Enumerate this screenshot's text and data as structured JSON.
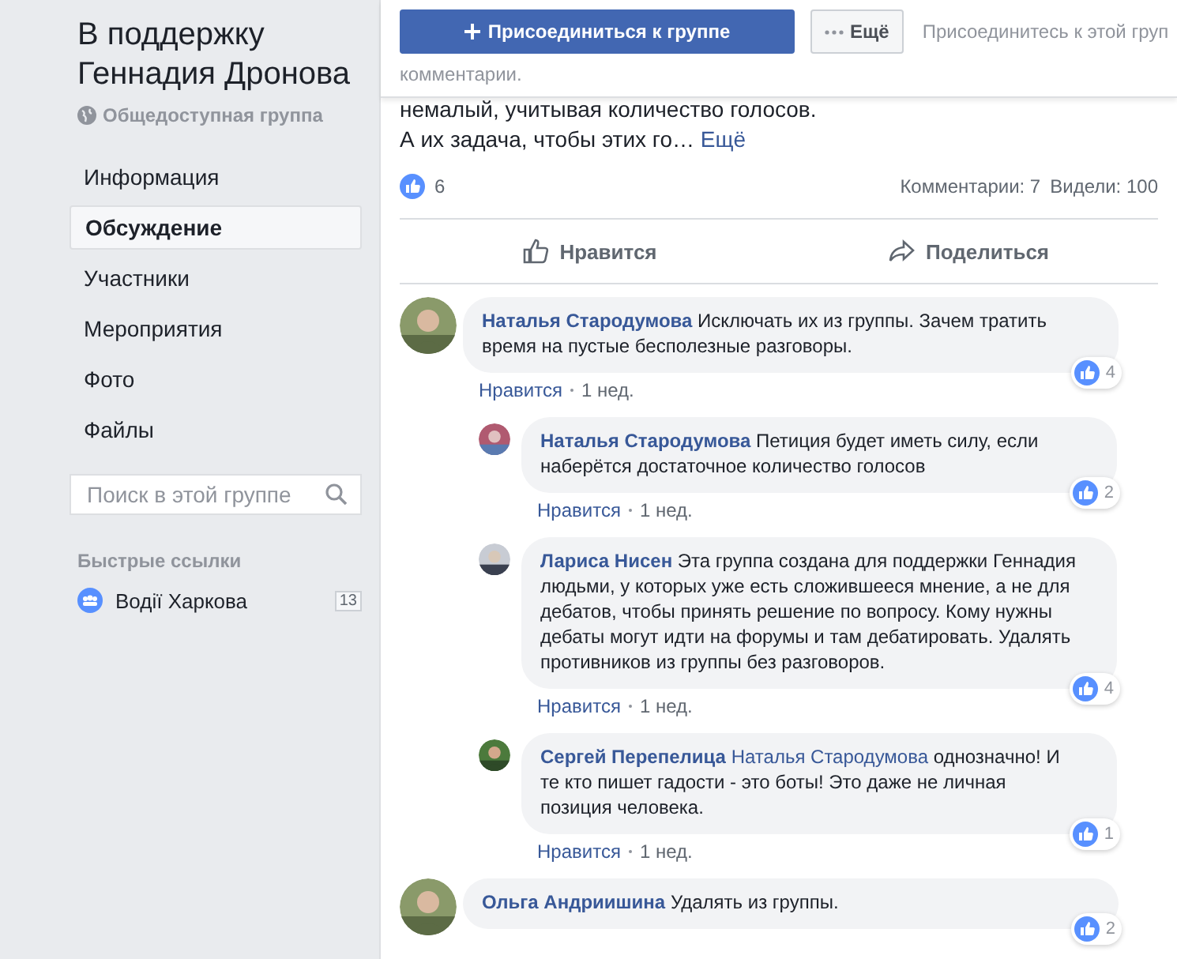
{
  "group": {
    "title": "В поддержку Геннадия Дронова",
    "privacy": "Общедоступная группа"
  },
  "nav": [
    {
      "label": "Информация",
      "selected": false
    },
    {
      "label": "Обсуждение",
      "selected": true
    },
    {
      "label": "Участники",
      "selected": false
    },
    {
      "label": "Мероприятия",
      "selected": false
    },
    {
      "label": "Фото",
      "selected": false
    },
    {
      "label": "Файлы",
      "selected": false
    }
  ],
  "search": {
    "placeholder": "Поиск в этой группе"
  },
  "quick_links": {
    "heading": "Быстрые ссылки",
    "items": [
      {
        "label": "Водії Харкова",
        "count": "13"
      }
    ]
  },
  "join_bar": {
    "join_button": "Присоединиться к группе",
    "more_button": "Ещё",
    "hint": "Присоединитесь к этой груп",
    "hint_line_2": "комментарии."
  },
  "post": {
    "text_lines": [
      "немалый, учитывая количество голосов.",
      "А их задача, чтобы этих го…"
    ],
    "more_link": "Ещё",
    "likes": "6",
    "comments": "Комментарии: 7",
    "views": "Видели: 100",
    "like_action": "Нравится",
    "share_action": "Поделиться"
  },
  "comments": [
    {
      "author": "Наталья Стародумова",
      "text": "Исключать их из группы. Зачем тратить время на пустые бесполезные разговоры.",
      "like": "Нравится",
      "time": "1 нед.",
      "reactions": "4",
      "children": [
        {
          "author": "Наталья Стародумова",
          "text": "Петиция будет иметь силу, если наберётся достаточное количество голосов",
          "like": "Нравится",
          "time": "1 нед.",
          "reactions": "2"
        },
        {
          "author": "Лариса Нисен",
          "text": "Эта группа создана для поддержки Геннадия людьми, у которых уже есть сложившееся мнение, а не для дебатов, чтобы принять решение по вопросу. Кому нужны дебаты могут идти на форумы и там дебатировать. Удалять противников из группы без разговоров.",
          "like": "Нравится",
          "time": "1 нед.",
          "reactions": "4"
        },
        {
          "author": "Сергей Перепелица",
          "mention": "Наталья Стародумова",
          "text": "однозначно! И те кто пишет гадости - это боты! Это даже не личная позиция человека.",
          "like": "Нравится",
          "time": "1 нед.",
          "reactions": "1"
        }
      ]
    },
    {
      "author": "Ольга Андриишина",
      "text": "Удалять из группы.",
      "reactions": "2"
    }
  ]
}
